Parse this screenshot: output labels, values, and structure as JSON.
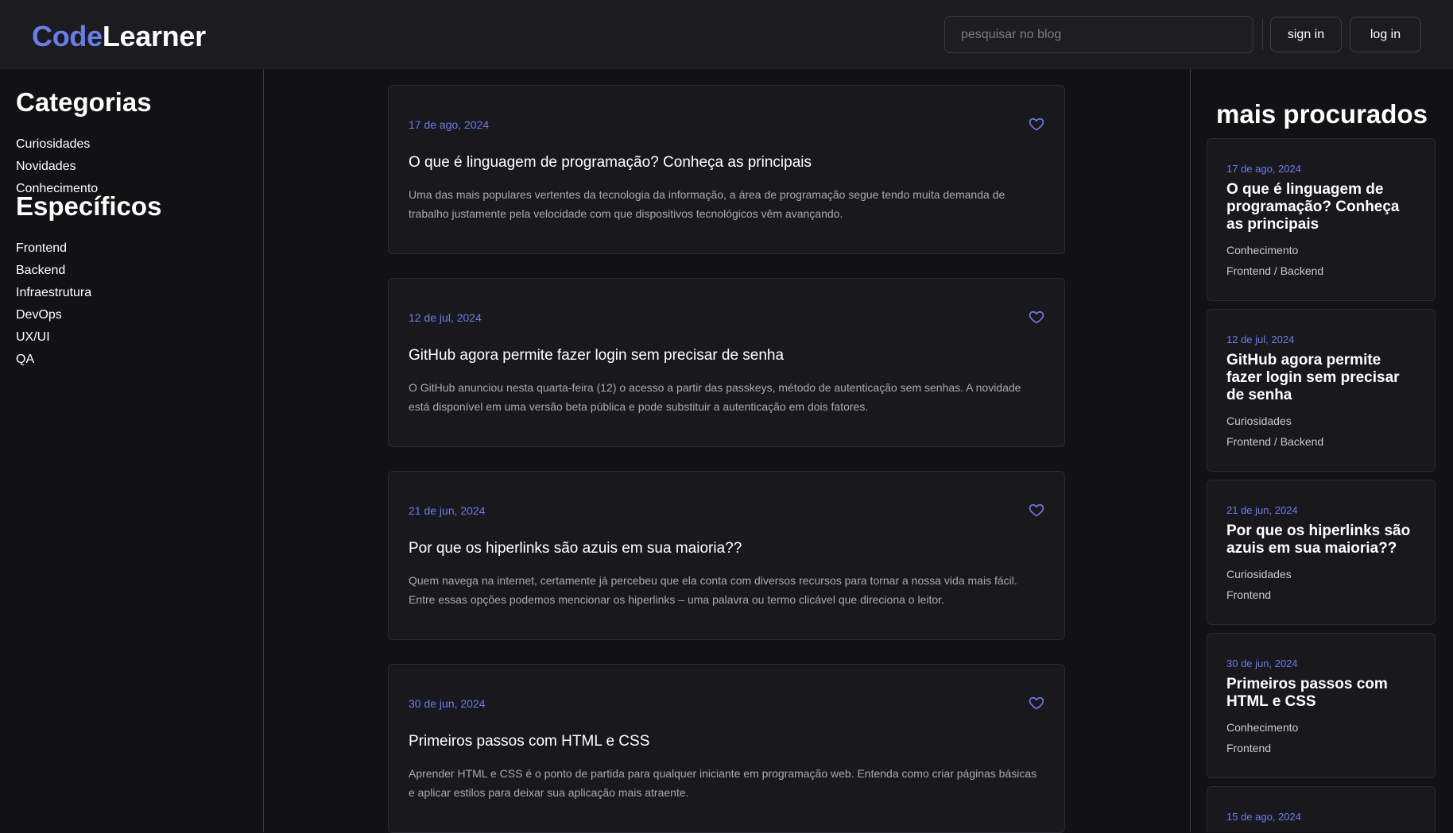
{
  "header": {
    "logo_part1": "Code",
    "logo_part2": "Learner",
    "search_placeholder": "pesquisar no blog",
    "signin_label": "sign in",
    "login_label": "log in"
  },
  "sidebar": {
    "categories_heading": "Categorias",
    "categories": [
      "Curiosidades",
      "Novidades",
      "Conhecimento"
    ],
    "specifics_heading": "Específicos",
    "specifics": [
      "Frontend",
      "Backend",
      "Infraestrutura",
      "DevOps",
      "UX/UI",
      "QA"
    ]
  },
  "posts": [
    {
      "date": "17 de ago, 2024",
      "title": "O que é linguagem de programação? Conheça as principais",
      "excerpt": "Uma das mais populares vertentes da tecnologia da informação, a área de programação segue tendo muita demanda de trabalho justamente pela velocidade com que dispositivos tecnológicos vêm avançando."
    },
    {
      "date": "12 de jul, 2024",
      "title": "GitHub agora permite fazer login sem precisar de senha",
      "excerpt": "O GitHub anunciou nesta quarta-feira (12) o acesso a partir das passkeys, método de autenticação sem senhas. A novidade está disponível em uma versão beta pública e pode substituir a autenticação em dois fatores."
    },
    {
      "date": "21 de jun, 2024",
      "title": "Por que os hiperlinks são azuis em sua maioria??",
      "excerpt": "Quem navega na internet, certamente já percebeu que ela conta com diversos recursos para tornar a nossa vida mais fácil. Entre essas opções podemos mencionar os hiperlinks – uma palavra ou termo clicável que direciona o leitor."
    },
    {
      "date": "30 de jun, 2024",
      "title": "Primeiros passos com HTML e CSS",
      "excerpt": "Aprender HTML e CSS é o ponto de partida para qualquer iniciante em programação web. Entenda como criar páginas básicas e aplicar estilos para deixar sua aplicação mais atraente."
    }
  ],
  "popular": {
    "heading": "mais procurados",
    "items": [
      {
        "date": "17 de ago, 2024",
        "title": "O que é linguagem de programação? Conheça as principais",
        "category": "Conhecimento",
        "tags": "Frontend / Backend"
      },
      {
        "date": "12 de jul, 2024",
        "title": "GitHub agora permite fazer login sem precisar de senha",
        "category": "Curiosidades",
        "tags": "Frontend / Backend"
      },
      {
        "date": "21 de jun, 2024",
        "title": "Por que os hiperlinks são azuis em sua maioria??",
        "category": "Curiosidades",
        "tags": "Frontend"
      },
      {
        "date": "30 de jun, 2024",
        "title": "Primeiros passos com HTML e CSS",
        "category": "Conhecimento",
        "tags": "Frontend"
      },
      {
        "date": "15 de ago, 2024"
      }
    ]
  },
  "colors": {
    "accent": "#6c7ce6",
    "background": "#121215",
    "card": "#19191d"
  },
  "icons": {
    "favorite": "heart-icon"
  }
}
